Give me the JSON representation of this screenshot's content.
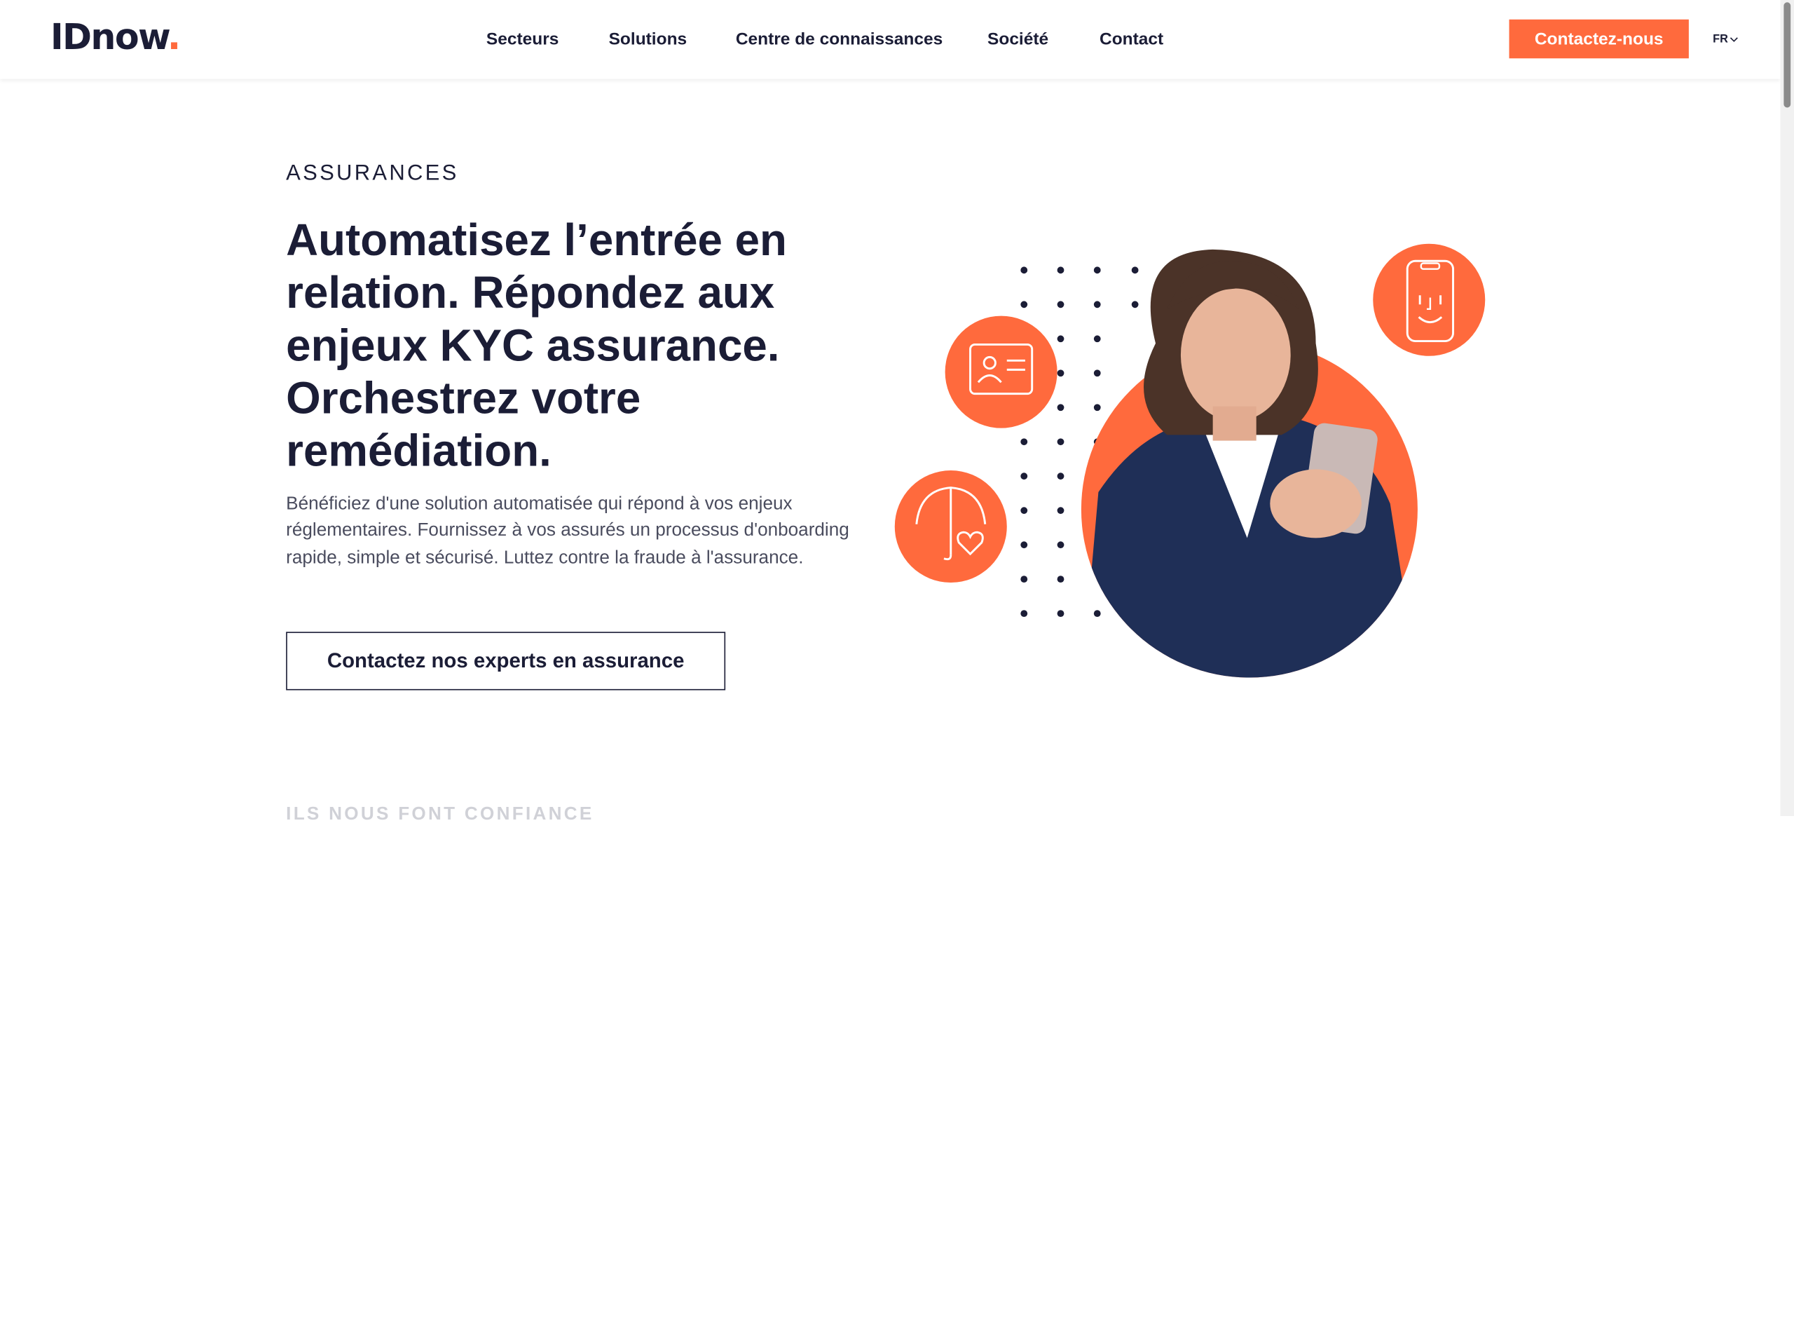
{
  "header": {
    "logo_text": "IDnow",
    "logo_dot": ".",
    "nav": [
      "Secteurs",
      "Solutions",
      "Centre de connaissances",
      "Société",
      "Contact"
    ],
    "cta_label": "Contactez-nous",
    "lang_label": "FR"
  },
  "hero": {
    "eyebrow": "ASSURANCES",
    "headline": "Automatisez l’entrée en relation. Répondez aux enjeux KYC assurance. Orchestrez votre remédiation.",
    "paragraph": "Bénéficiez d'une solution automatisée qui répond à vos enjeux réglementaires. Fournissez à vos assurés un processus d'onboarding rapide, simple et sécurisé. Luttez contre la fraude à l'assurance.",
    "cta_label": "Contactez nos experts en assurance",
    "icons": [
      "id-card-icon",
      "umbrella-heart-icon",
      "face-id-phone-icon"
    ]
  },
  "next_section": {
    "faded_title": "ILS NOUS FONT CONFIANCE"
  },
  "colors": {
    "accent": "#ff6a3d",
    "text": "#1b1d36"
  }
}
